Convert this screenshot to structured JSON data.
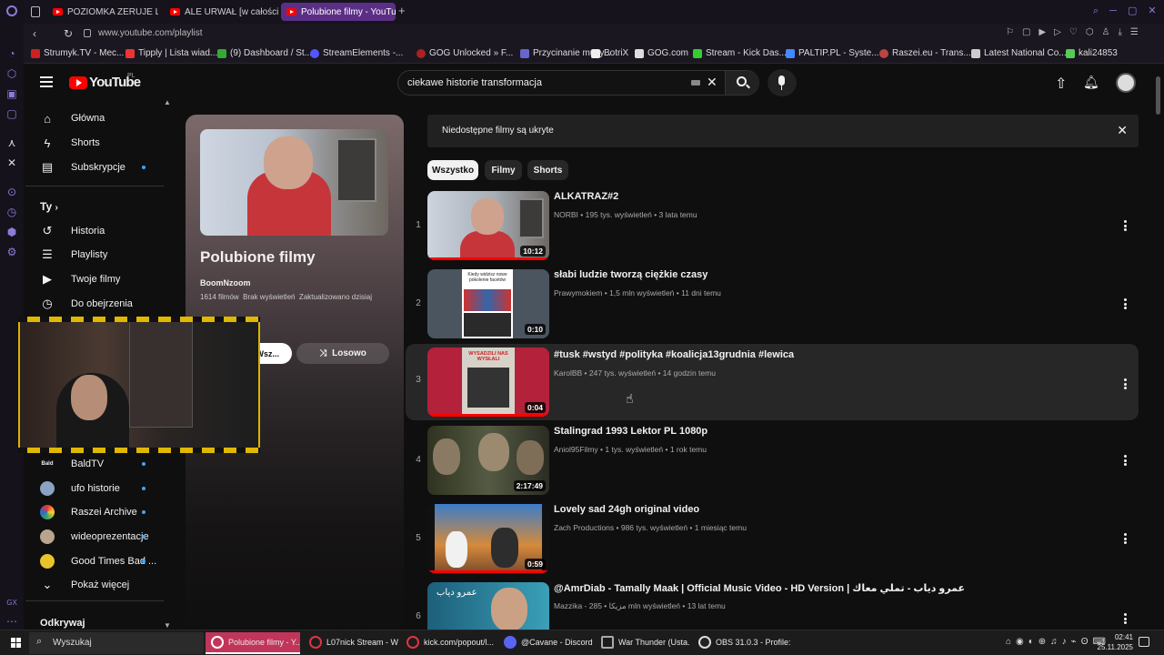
{
  "browser": {
    "tabs": [
      {
        "label": "POZIOMKA ZERUJE LITR"
      },
      {
        "label": "ALE URWAŁ [w całości -"
      },
      {
        "label": "Polubione filmy - YouTube"
      }
    ],
    "url": "www.youtube.com/playlist",
    "bookmarks": [
      "Strumyk.TV - Mec...",
      "Tipply | Lista wiad...",
      "(9) Dashboard / St...",
      "StreamElements -...",
      "GOG Unlocked » F...",
      "Przycinanie muzy...",
      "BotriX",
      "GOG.com",
      "Stream - Kick Das...",
      "PALTIP.PL - Syste...",
      "Raszei.eu - Trans...",
      "Latest National Co...",
      "kali24853"
    ]
  },
  "yt": {
    "logo_text": "YouTube",
    "logo_region": "PL",
    "search_value": "ciekawe historie transformacja"
  },
  "nav": {
    "main": [
      {
        "label": "Główna"
      },
      {
        "label": "Shorts"
      },
      {
        "label": "Subskrypcje"
      }
    ],
    "you_title": "Ty",
    "you": [
      {
        "label": "Historia"
      },
      {
        "label": "Playlisty"
      },
      {
        "label": "Twoje filmy"
      },
      {
        "label": "Do obejrzenia"
      }
    ],
    "subs": [
      {
        "label": "BaldTV"
      },
      {
        "label": "ufo historie"
      },
      {
        "label": "Raszei Archive"
      },
      {
        "label": "wideoprezentacje"
      },
      {
        "label": "Good Times Bad ..."
      }
    ],
    "show_more": "Pokaż więcej",
    "explore": "Odkrywaj"
  },
  "playlist": {
    "title": "Polubione filmy",
    "owner": "BoomNzoom",
    "meta": "1614 filmów  Brak wyświetleń  Zaktualizowano dzisiaj",
    "play_all": "Wsz...",
    "shuffle": "Losowo"
  },
  "banner": {
    "text": "Niedostępne filmy są ukryte"
  },
  "chips": [
    {
      "label": "Wszystko"
    },
    {
      "label": "Filmy"
    },
    {
      "label": "Shorts"
    }
  ],
  "videos": [
    {
      "index": "1",
      "title": "ALKATRAZ#2",
      "meta": "NORBI • 195 tys. wyświetleń • 3 lata temu",
      "duration": "10:12"
    },
    {
      "index": "2",
      "title": "słabi ludzie tworzą ciężkie czasy",
      "meta": "Prawymokiem • 1,5 mln wyświetleń • 11 dni temu",
      "duration": "0:10"
    },
    {
      "index": "3",
      "title": "#tusk #wstyd #polityka #koalicja13grudnia #lewica",
      "meta": "KarolBB • 247 tys. wyświetleń • 14 godzin temu",
      "duration": "0:04"
    },
    {
      "index": "4",
      "title": "Stalingrad 1993 Lektor PL 1080p",
      "meta": "Aniol95Filmy • 1 tys. wyświetleń • 1 rok temu",
      "duration": "2:17:49"
    },
    {
      "index": "5",
      "title": "Lovely sad 24gh original video",
      "meta": "Zach Productions • 986 tys. wyświetleń • 1 miesiąc temu",
      "duration": "0:59"
    },
    {
      "index": "6",
      "title": "@AmrDiab - Tamally Maak | Official Music Video - HD Version | عمرو دياب - تملي معاك",
      "meta": "Mazzika - مزيكا • 285 mln wyświetleń • 13 lat temu",
      "duration": ""
    }
  ],
  "thumb_texts": {
    "t2": "Kiedy widzisz nowe pokolenie facetów",
    "t3": "WYSADZILI NAS WYSŁALI",
    "t6": "عمرو دياب"
  },
  "taskbar": {
    "search": "Wyszukaj",
    "apps": [
      {
        "label": "Polubione filmy - Y..."
      },
      {
        "label": "L07nick Stream - W..."
      },
      {
        "label": "kick.com/popout/l..."
      },
      {
        "label": "@Cavane - Discord"
      },
      {
        "label": "War Thunder (Ustа..."
      },
      {
        "label": "OBS 31.0.3 - Profile:..."
      }
    ],
    "time": "02:41",
    "date": "25.11.2025"
  }
}
